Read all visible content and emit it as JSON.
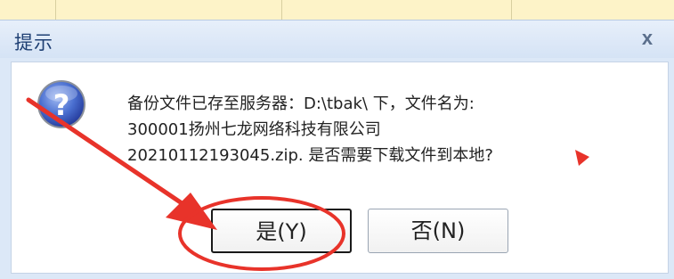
{
  "dialog": {
    "title": "提示",
    "close_label": "x",
    "message_lines": [
      "备份文件已存至服务器：D:\\tbak\\ 下，文件名为:",
      "300001扬州七龙网络科技有限公司",
      "20210112193045.zip. 是否需要下载文件到本地?"
    ],
    "buttons": {
      "yes": "是(Y)",
      "no": "否(N)"
    }
  },
  "icons": {
    "question": "question-icon"
  },
  "colors": {
    "annotation": "#e8332a",
    "dialog_bg": "#dce8f7",
    "title": "#1e3f73"
  }
}
